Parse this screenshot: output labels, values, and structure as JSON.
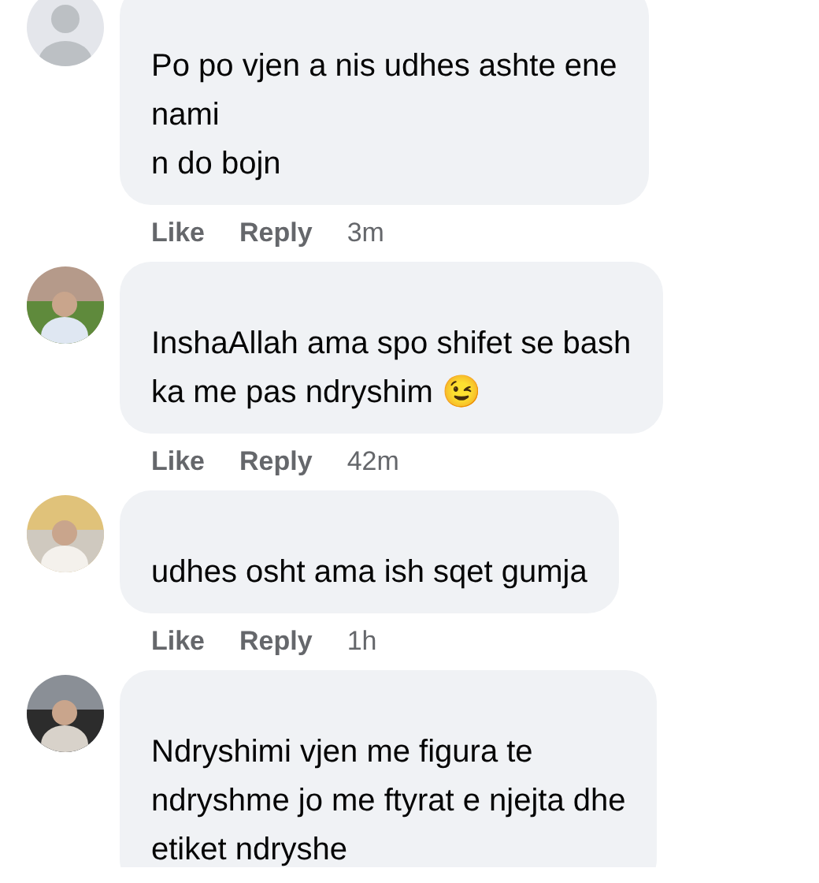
{
  "comments": [
    {
      "avatar": {
        "kind": "default"
      },
      "text": "Po po vjen a nis udhes ashte ene\nnami\nn do bojn",
      "actions": [
        "Like",
        "Reply"
      ],
      "time": "3m"
    },
    {
      "text": "InshaAllah ama spo shifet se bash\nka me pas ndryshim 😉",
      "actions": [
        "Like",
        "Reply"
      ],
      "time": "42m"
    },
    {
      "text": "udhes osht ama ish sqet gumja",
      "actions": [
        "Like",
        "Reply"
      ],
      "time": "1h"
    },
    {
      "text": "Ndryshimi vjen me figura te\nndryshme jo me ftyrat e njejta dhe\netiket ndryshe"
    }
  ]
}
